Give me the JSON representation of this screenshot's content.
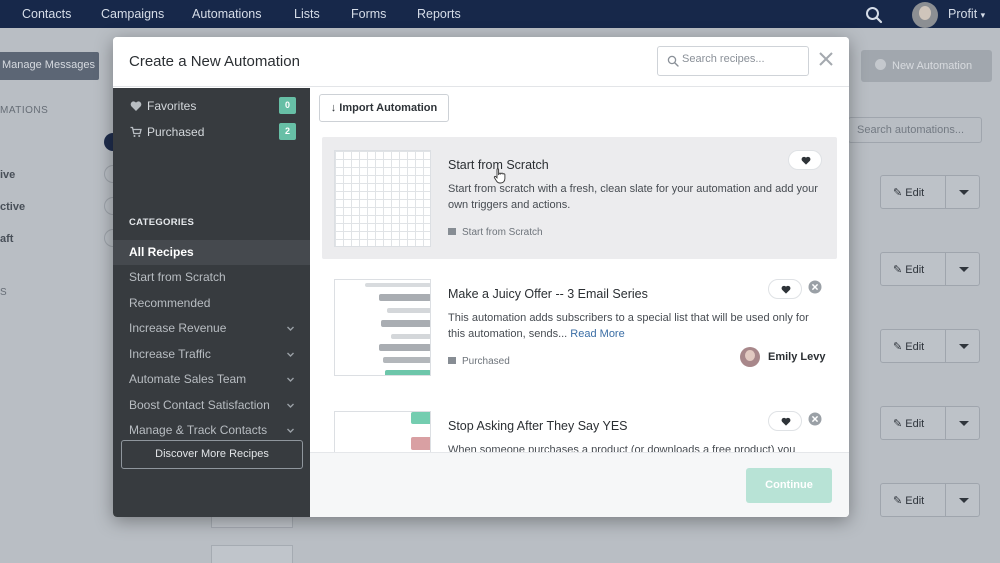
{
  "topnav": {
    "items": [
      "Contacts",
      "Campaigns",
      "Automations",
      "Lists",
      "Forms",
      "Reports"
    ],
    "profile_label": "Profit"
  },
  "background": {
    "manage_messages": "Manage Messages",
    "new_automation": "New Automation",
    "side_label_1": "MATIONS",
    "status_labels": [
      "ive",
      "ctive",
      "aft"
    ],
    "side_label_2": "S",
    "search_automations_placeholder": "Search automations...",
    "edit_label": "Edit"
  },
  "modal": {
    "title": "Create a New Automation",
    "search_placeholder": "Search recipes...",
    "sidebar": {
      "favorites": {
        "label": "Favorites",
        "count": "0"
      },
      "purchased": {
        "label": "Purchased",
        "count": "2"
      },
      "categories_heading": "CATEGORIES",
      "categories": [
        {
          "label": "All Recipes"
        },
        {
          "label": "Start from Scratch"
        },
        {
          "label": "Recommended"
        },
        {
          "label": "Increase Revenue"
        },
        {
          "label": "Increase Traffic"
        },
        {
          "label": "Automate Sales Team"
        },
        {
          "label": "Boost Contact Satisfaction"
        },
        {
          "label": "Manage & Track Contacts"
        }
      ],
      "discover_label": "Discover More Recipes"
    },
    "import_label": "Import Automation",
    "recipes": [
      {
        "title": "Start from Scratch",
        "description": "Start from scratch with a fresh, clean slate for your automation and add your own triggers and actions.",
        "tag": "Start from Scratch"
      },
      {
        "title": "Make a Juicy Offer -- 3 Email Series",
        "description": "This automation adds subscribers to a special list that will be used only for this automation, sends... ",
        "read_more": "Read More",
        "tag": "Purchased",
        "author": "Emily Levy"
      },
      {
        "title": "Stop Asking After They Say YES",
        "description": "When someone purchases a product (or downloads a free product) you"
      }
    ],
    "continue_label": "Continue"
  },
  "colors": {
    "nav_bg": "#17284a",
    "sidebar_bg": "#373b3f",
    "badge": "#67bfa6",
    "continue_disabled": "#b8e3d6"
  }
}
